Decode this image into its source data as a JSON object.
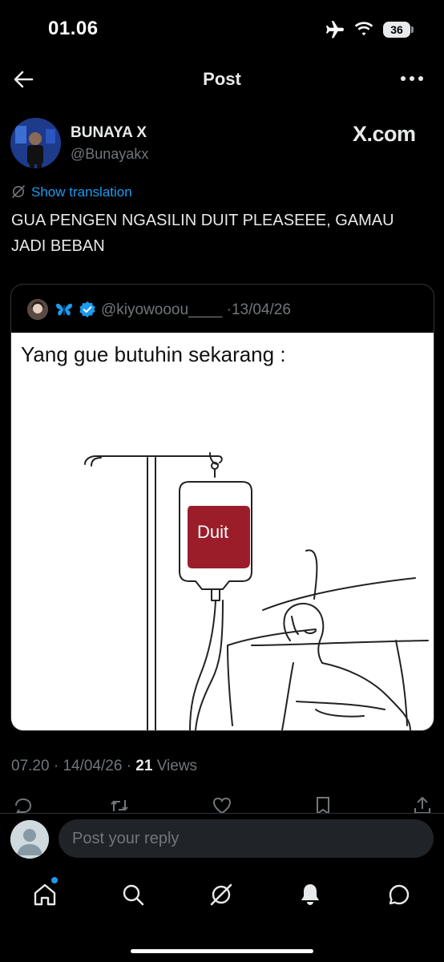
{
  "status_bar": {
    "time": "01.06",
    "battery": "36"
  },
  "header": {
    "title": "Post"
  },
  "author": {
    "name": "BUNAYA X",
    "handle": "@Bunayakx",
    "watermark": "X.com"
  },
  "translation": {
    "label": "Show translation"
  },
  "post": {
    "text": "GUA PENGEN NGASILIN DUIT PLEASEEE, GAMAU JADI BEBAN"
  },
  "quote": {
    "handle": "@kiyowooou____",
    "date": "13/04/26",
    "caption": "Yang gue butuhin sekarang :",
    "bag_label": "Duit"
  },
  "meta": {
    "time": "07.20",
    "date": "14/04/26",
    "views_count": "21",
    "views_label": "Views",
    "sep": "·"
  },
  "reply": {
    "placeholder": "Post your reply"
  },
  "colors": {
    "accent": "#1d9bf0",
    "background": "#000000",
    "bag": "#9b1d2a"
  }
}
